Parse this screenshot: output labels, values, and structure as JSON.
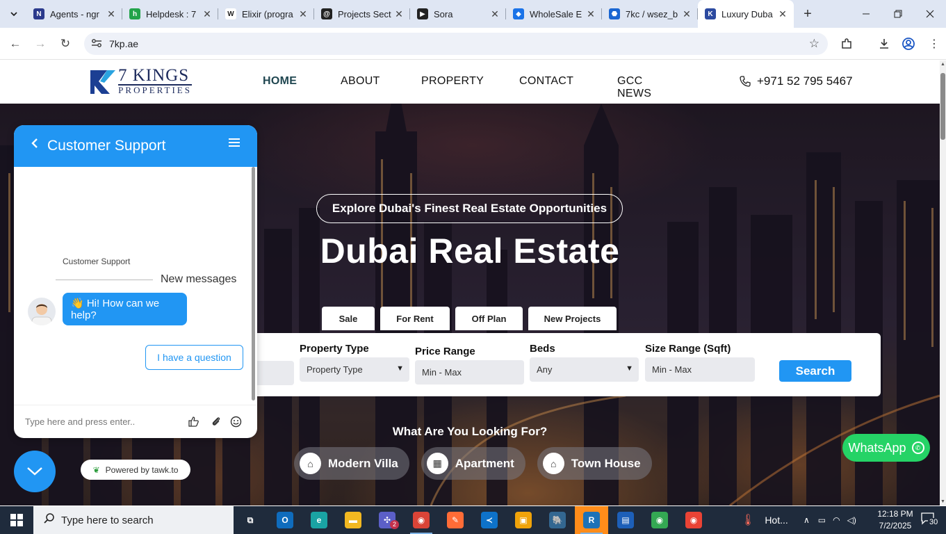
{
  "browser": {
    "tabs": [
      {
        "title": "Agents - ngr",
        "fav": "N",
        "color": "#2b3a8c"
      },
      {
        "title": "Helpdesk : 7",
        "fav": "h",
        "color": "#22a34a"
      },
      {
        "title": "Elixir (progra",
        "fav": "W",
        "color": "#ffffff"
      },
      {
        "title": "Projects Sect",
        "fav": "@",
        "color": "#222222"
      },
      {
        "title": "Sora",
        "fav": "▶",
        "color": "#222222"
      },
      {
        "title": "WholeSale E",
        "fav": "◆",
        "color": "#1a73e8"
      },
      {
        "title": "7kc / wsez_b",
        "fav": "⬣",
        "color": "#1a66d2"
      },
      {
        "title": "Luxury Duba",
        "fav": "K",
        "color": "#2c4aa0"
      }
    ],
    "url": "7kp.ae"
  },
  "header": {
    "logo_main": "7 KINGS",
    "logo_sub": "PROPERTIES",
    "nav": [
      "HOME",
      "ABOUT",
      "PROPERTY",
      "CONTACT",
      "GCC NEWS"
    ],
    "phone": "+971 52 795 5467"
  },
  "hero": {
    "tagline": "Explore Dubai's Finest Real Estate Opportunities",
    "title": "Dubai Real Estate",
    "filter_tabs": [
      "Sale",
      "For Rent",
      "Off Plan",
      "New Projects"
    ],
    "fields": {
      "property_type_label": "Property Type",
      "property_type_value": "Property Type",
      "price_label": "Price Range",
      "price_value": "Min - Max",
      "beds_label": "Beds",
      "beds_value": "Any",
      "size_label": "Size Range (Sqft)",
      "size_value": "Min - Max"
    },
    "search_label": "Search",
    "looking_for": "What Are You Looking For?",
    "categories": [
      "Modern Villa",
      "Apartment",
      "Town House"
    ],
    "whatsapp": "WhatsApp"
  },
  "chat": {
    "title": "Customer Support",
    "agent_name": "Customer Support",
    "new_messages": "New messages",
    "greeting": "👋 Hi! How can we help?",
    "quick_reply": "I have a question",
    "input_placeholder": "Type here and press enter..",
    "powered_by": "Powered by tawk.to"
  },
  "taskbar": {
    "search_placeholder": "Type here to search",
    "weather": "Hot...",
    "time": "12:18 PM",
    "date": "7/2/2025",
    "notifications": "30",
    "teams_badge": "2"
  }
}
